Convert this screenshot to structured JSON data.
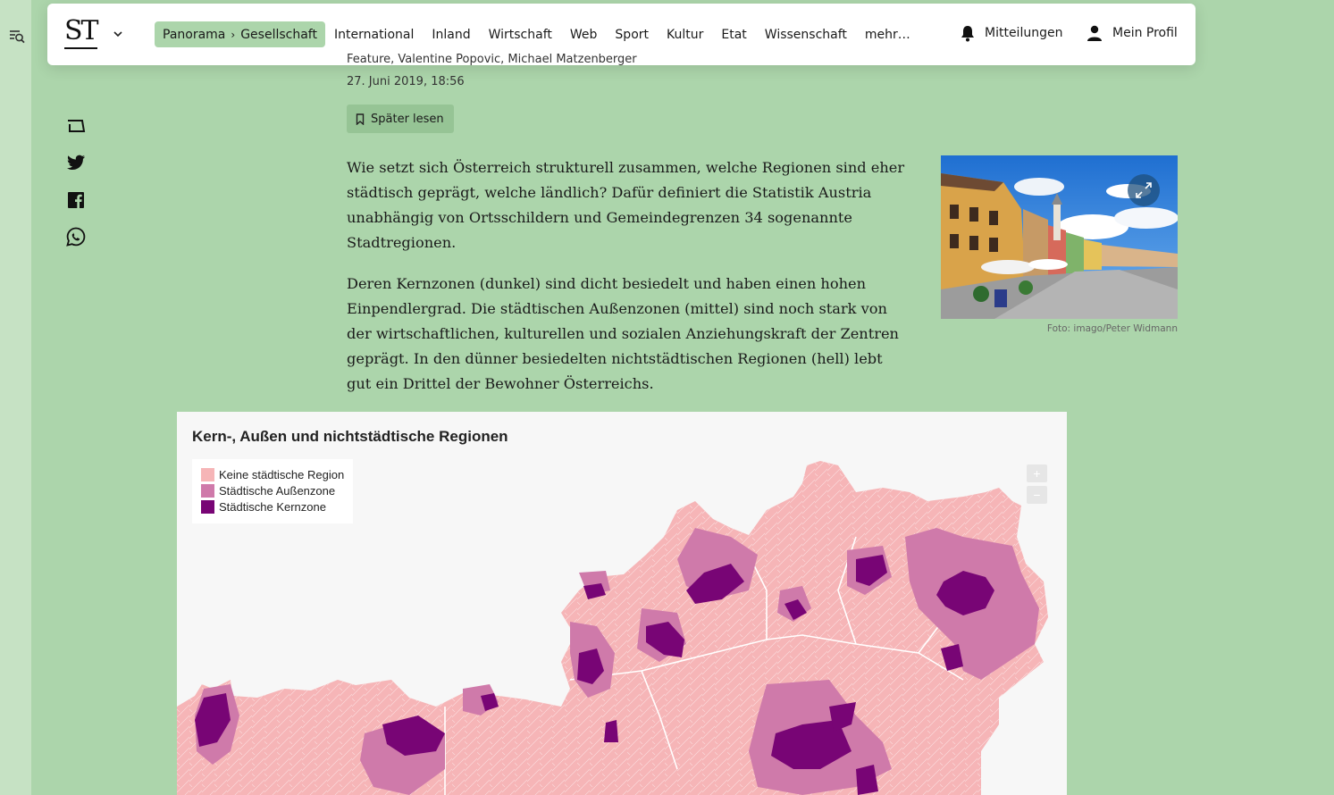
{
  "header": {
    "logo": "ST",
    "breadcrumb": {
      "section": "Panorama",
      "subsection": "Gesellschaft"
    },
    "nav": [
      "International",
      "Inland",
      "Wirtschaft",
      "Web",
      "Sport",
      "Kultur",
      "Etat",
      "Wissenschaft",
      "mehr…"
    ],
    "notifications_label": "Mitteilungen",
    "profile_label": "Mein Profil"
  },
  "article": {
    "byline_partial": "Feature, Valentine Popovic, Michael Matzenberger",
    "date": "27. Juni 2019, 18:56",
    "read_later_label": "Später lesen",
    "paragraphs": [
      "Wie setzt sich Österreich strukturell zusammen, welche Regionen sind eher städtisch geprägt, welche ländlich? Dafür definiert die Statistik Austria unabhängig von Ortsschildern und Gemeindegrenzen 34 sogenannte Stadtregionen.",
      "Deren Kernzonen (dunkel) sind dicht besiedelt und haben einen hohen Einpendlergrad. Die städtischen Außenzonen (mittel) sind noch stark von der wirtschaftlichen, kulturellen und sozialen Anziehungskraft der Zentren geprägt. In den dünner besiedelten nichtstädtischen Regionen (hell) lebt gut ein Drittel der Bewohner Österreichs."
    ],
    "photo_credit": "Foto: imago/Peter Widmann"
  },
  "map": {
    "title": "Kern-, Außen und nichtstädtische Regionen",
    "legend": [
      {
        "label": "Keine städtische Region",
        "color": "#f6b5b7"
      },
      {
        "label": "Städtische Außenzone",
        "color": "#cf7aaa"
      },
      {
        "label": "Städtische Kernzone",
        "color": "#780575"
      }
    ],
    "zoom_in": "+",
    "zoom_out": "−"
  },
  "icons": {
    "left_rail": "search-list-icon",
    "share": [
      "speech-bubble-icon",
      "twitter-icon",
      "facebook-icon",
      "whatsapp-icon"
    ],
    "bell": "bell-icon",
    "profile": "user-icon",
    "bookmark": "bookmark-icon",
    "expand": "expand-icon"
  },
  "colors": {
    "page_bg": "#acd5ab",
    "crumb_bg": "#acd5ab",
    "button_bg": "#96c495"
  }
}
